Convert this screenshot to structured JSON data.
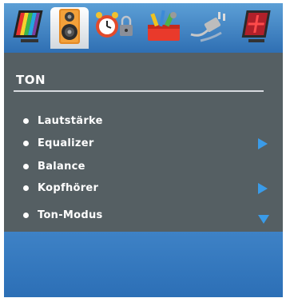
{
  "tabs": [
    {
      "name": "picture-icon"
    },
    {
      "name": "speaker-icon"
    },
    {
      "name": "alarm-clock-icon"
    },
    {
      "name": "toolbox-icon"
    },
    {
      "name": "plug-icon"
    },
    {
      "name": "source-icon"
    }
  ],
  "menu": {
    "title": "TON",
    "items": [
      {
        "label": "Lautstärke",
        "has_submenu": false
      },
      {
        "label": "Equalizer",
        "has_submenu": true
      },
      {
        "label": "Balance",
        "has_submenu": false
      },
      {
        "label": "Kopfhörer",
        "has_submenu": true
      },
      {
        "label": "Ton-Modus",
        "has_submenu": false,
        "has_dropdown": true
      }
    ]
  },
  "colors": {
    "topbar": "#4a8fd0",
    "panel": "#555f63",
    "footer": "#3a7ec4",
    "arrow": "#3a9be8"
  }
}
